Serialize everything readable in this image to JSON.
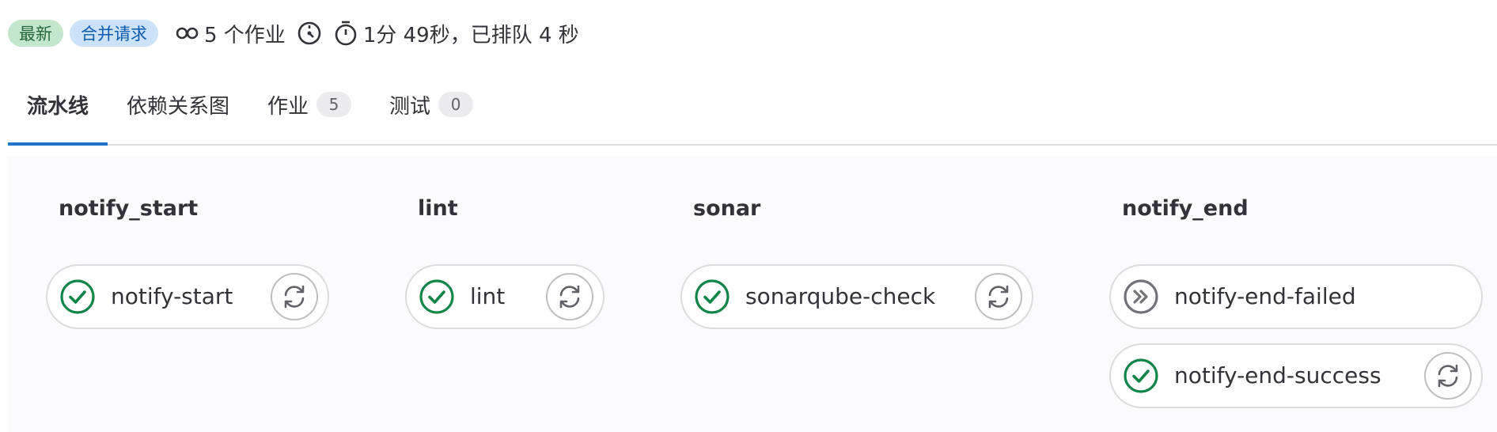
{
  "header": {
    "badge_latest": "最新",
    "badge_merge_request": "合并请求",
    "jobs_count": "5 个作业",
    "duration": "1分 49秒，已排队 4 秒"
  },
  "tabs": [
    {
      "label": "流水线",
      "active": true
    },
    {
      "label": "依赖关系图"
    },
    {
      "label": "作业",
      "count": "5"
    },
    {
      "label": "测试",
      "count": "0"
    }
  ],
  "stages": [
    {
      "name": "notify_start",
      "jobs": [
        {
          "name": "notify-start",
          "status": "success",
          "action": "retry"
        }
      ]
    },
    {
      "name": "lint",
      "jobs": [
        {
          "name": "lint",
          "status": "success",
          "action": "retry"
        }
      ]
    },
    {
      "name": "sonar",
      "jobs": [
        {
          "name": "sonarqube-check",
          "status": "success",
          "action": "retry"
        }
      ]
    },
    {
      "name": "notify_end",
      "jobs": [
        {
          "name": "notify-end-failed",
          "status": "skipped"
        },
        {
          "name": "notify-end-success",
          "status": "success",
          "action": "retry"
        }
      ]
    }
  ],
  "colors": {
    "success": "#108548",
    "skipped": "#737278",
    "accent": "#1f75cb"
  }
}
